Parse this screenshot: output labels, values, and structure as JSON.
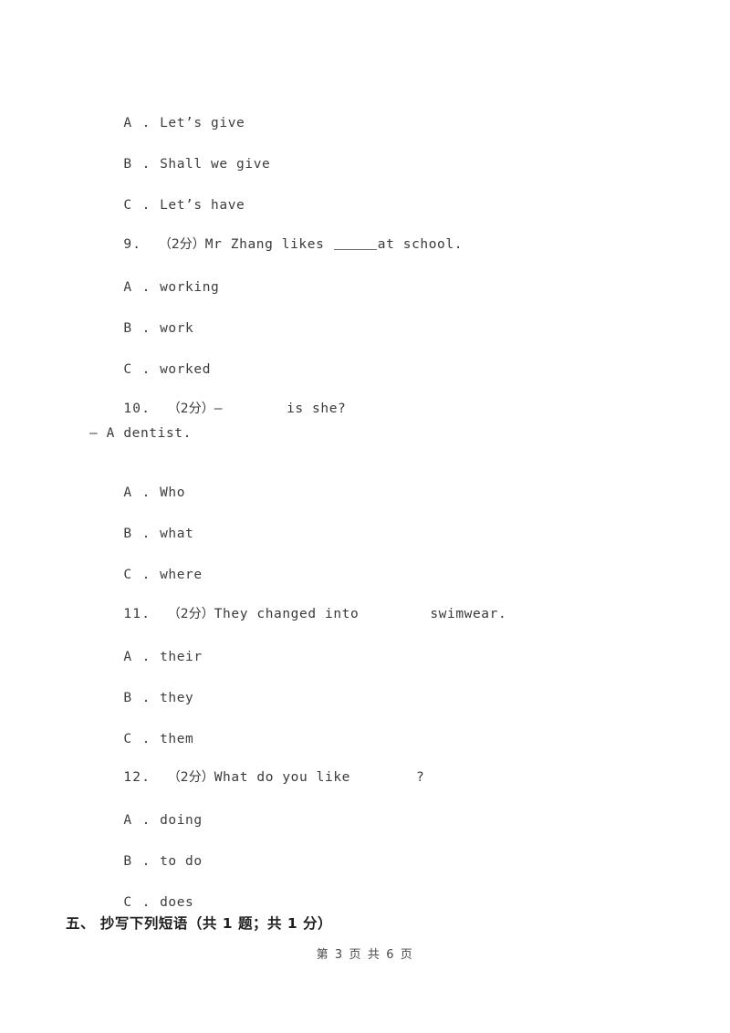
{
  "document": {
    "page_background": "#ffffff",
    "text_color": "#39393b"
  },
  "content": {
    "orphan_options_top": [
      {
        "mark": "A .",
        "text": "Let’s give"
      },
      {
        "mark": "B .",
        "text": "Shall we give"
      },
      {
        "mark": "C .",
        "text": "Let’s have"
      }
    ],
    "questions": [
      {
        "number": "9.",
        "score": "（2分）",
        "stem_before": "Mr Zhang likes ",
        "blank_type": "underline",
        "stem_after": "at school.",
        "options": [
          {
            "mark": "A .",
            "text": "working"
          },
          {
            "mark": "B .",
            "text": "work"
          },
          {
            "mark": "C .",
            "text": "worked"
          }
        ]
      },
      {
        "number": "10.",
        "score": "（2分）",
        "stem_before": "—",
        "blank_type": "gap",
        "stem_after": "is she?",
        "continuation": "— A dentist.",
        "options": [
          {
            "mark": "A .",
            "text": "Who"
          },
          {
            "mark": "B .",
            "text": "what"
          },
          {
            "mark": "C .",
            "text": "where"
          }
        ]
      },
      {
        "number": "11.",
        "score": "（2分）",
        "stem_before": "They changed into",
        "blank_type": "gap",
        "stem_after": "swimwear.",
        "options": [
          {
            "mark": "A .",
            "text": "their"
          },
          {
            "mark": "B .",
            "text": "they"
          },
          {
            "mark": "C .",
            "text": "them"
          }
        ]
      },
      {
        "number": "12.",
        "score": "（2分）",
        "stem_before": "What do you like",
        "blank_type": "gap",
        "stem_after": "?",
        "options": [
          {
            "mark": "A .",
            "text": "doing"
          },
          {
            "mark": "B .",
            "text": "to do"
          },
          {
            "mark": "C .",
            "text": "does"
          }
        ]
      }
    ],
    "section_heading": "五、 抄写下列短语（共 1 题；共 1 分）",
    "footer": "第 3 页 共 6 页"
  }
}
